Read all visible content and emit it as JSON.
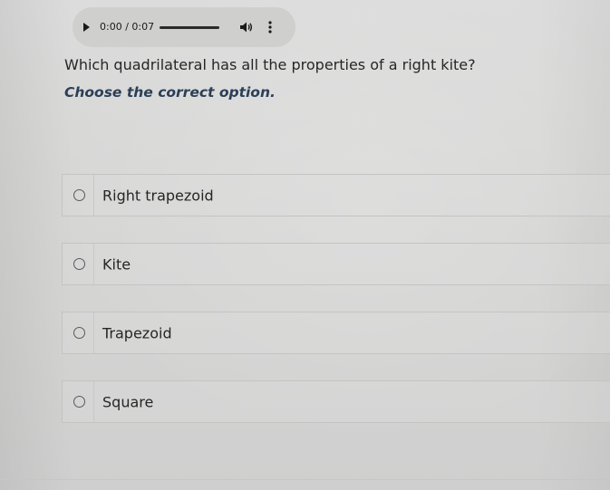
{
  "audio_player": {
    "current_time": "0:00",
    "separator": " / ",
    "duration": "0:07",
    "progress_fraction": 0,
    "play_icon": "play-icon",
    "volume_icon": "volume-icon",
    "more_icon": "more-vertical-icon"
  },
  "question": {
    "text": "Which quadrilateral has all the properties of a right kite?",
    "instruction": "Choose the correct option."
  },
  "options": [
    {
      "label": "Right trapezoid",
      "selected": false
    },
    {
      "label": "Kite",
      "selected": false
    },
    {
      "label": "Trapezoid",
      "selected": false
    },
    {
      "label": "Square",
      "selected": false
    }
  ],
  "colors": {
    "instruction": "#2b3f57",
    "text": "#262626",
    "background": "#d7d7d6"
  }
}
